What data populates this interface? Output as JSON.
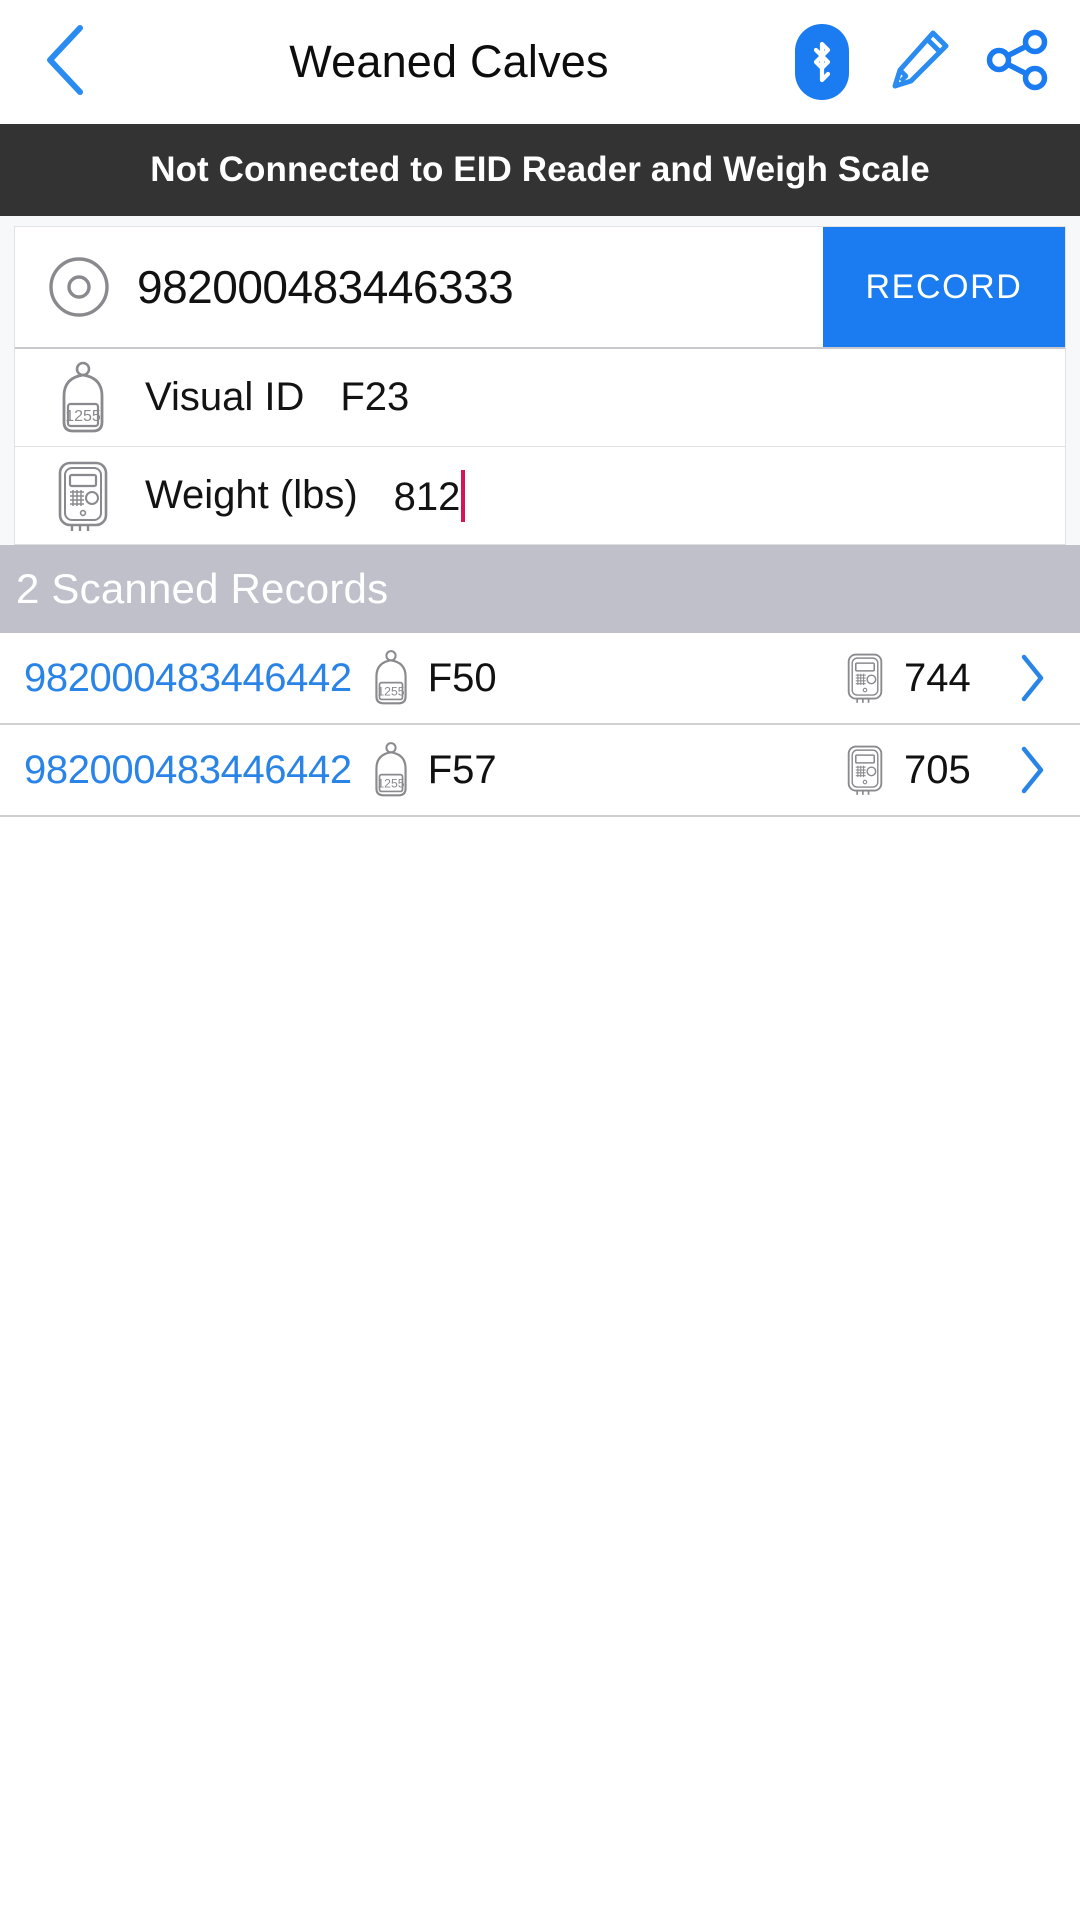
{
  "appbar": {
    "back_icon": "chevron-left-icon",
    "title": "Weaned Calves",
    "bluetooth_icon": "bluetooth-icon",
    "edit_icon": "pencil-icon",
    "share_icon": "share-icon"
  },
  "status": {
    "message": "Not Connected to EID Reader and Weigh Scale"
  },
  "entry": {
    "eid_icon": "rfid-tag-icon",
    "eid_value": "982000483446333",
    "record_label": "RECORD",
    "fields": [
      {
        "icon": "ear-tag-icon",
        "icon_text": "1255",
        "label": "Visual ID",
        "value": "F23",
        "has_caret": false
      },
      {
        "icon": "weigh-scale-indicator-icon",
        "label": "Weight (lbs)",
        "value": "812",
        "has_caret": true
      }
    ]
  },
  "section": {
    "title": "2 Scanned Records"
  },
  "records": [
    {
      "eid": "982000483446442",
      "tag_icon": "ear-tag-icon",
      "tag_icon_text": "1255",
      "visual_id": "F50",
      "scale_icon": "weigh-scale-indicator-icon",
      "weight": "744",
      "chevron_icon": "chevron-right-icon"
    },
    {
      "eid": "982000483446442",
      "tag_icon": "ear-tag-icon",
      "tag_icon_text": "1255",
      "visual_id": "F57",
      "scale_icon": "weigh-scale-indicator-icon",
      "weight": "705",
      "chevron_icon": "chevron-right-icon"
    }
  ],
  "colors": {
    "accent_blue": "#1a7cf0",
    "link_blue": "#2a84e8",
    "banner_dark": "#333333",
    "section_gray": "#bfc0c9",
    "caret_pink": "#d6145a"
  }
}
